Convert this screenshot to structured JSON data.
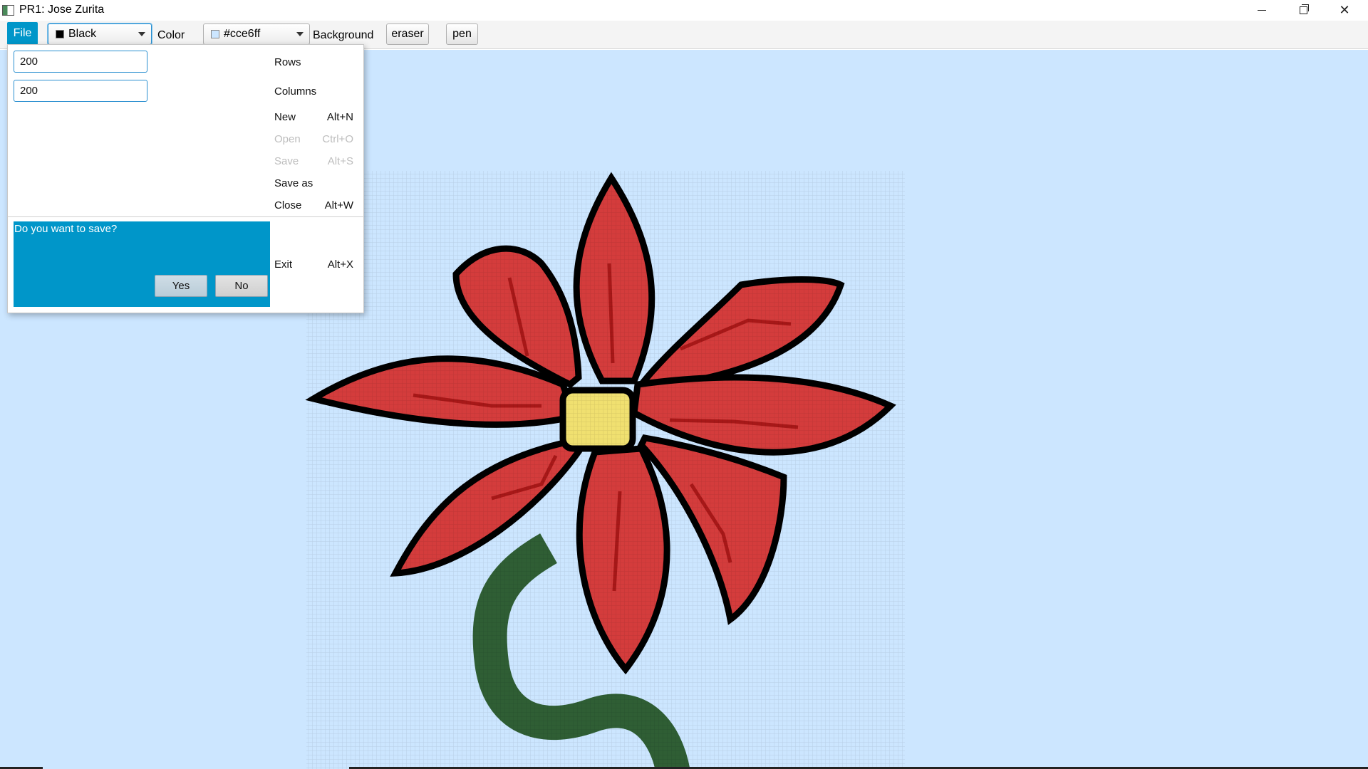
{
  "window": {
    "title": "PR1: Jose Zurita"
  },
  "toolbar": {
    "file_label": "File",
    "foreground_combo": {
      "value": "Black",
      "swatch_color": "#000000"
    },
    "color_label": "Color",
    "background_combo": {
      "value": "#cce6ff",
      "swatch_color": "#cce6ff"
    },
    "background_label": "Background",
    "eraser_label": "eraser",
    "pen_label": "pen"
  },
  "file_menu": {
    "rows_input": {
      "value": "200",
      "label": "Rows"
    },
    "columns_input": {
      "value": "200",
      "label": "Columns"
    },
    "items": [
      {
        "label": "New",
        "accelerator": "Alt+N",
        "enabled": true
      },
      {
        "label": "Open",
        "accelerator": "Ctrl+O",
        "enabled": false
      },
      {
        "label": "Save",
        "accelerator": "Alt+S",
        "enabled": false
      },
      {
        "label": "Save as",
        "accelerator": "",
        "enabled": true
      },
      {
        "label": "Close",
        "accelerator": "Alt+W",
        "enabled": true
      },
      {
        "label": "Exit",
        "accelerator": "Alt+X",
        "enabled": true
      }
    ],
    "save_prompt": {
      "question": "Do you want to save?",
      "yes_label": "Yes",
      "no_label": "No"
    }
  },
  "canvas": {
    "background_color": "#cce6ff",
    "drawing": "pixel-art red flower with yellow center and green stem",
    "colors": {
      "petal": "#d43c3c",
      "outline": "#000000",
      "vein": "#a81818",
      "center": "#f0e070",
      "stem": "#2f5e34"
    }
  },
  "accent_color": "#0096c9"
}
